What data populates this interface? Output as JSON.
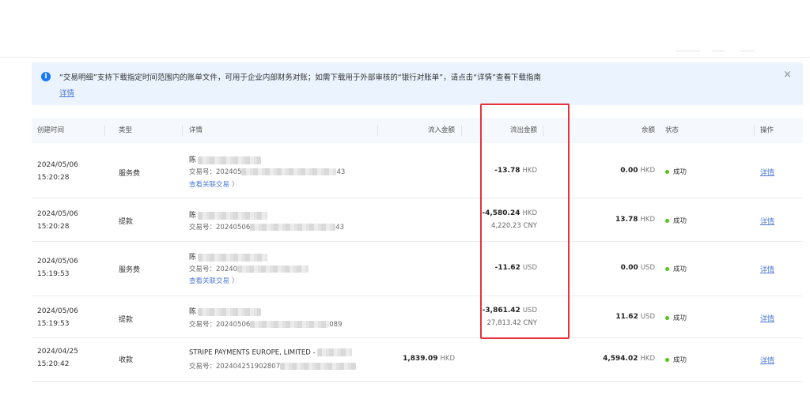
{
  "notice": {
    "message": "“交易明细”支持下载指定时间范围内的账单文件，可用于企业内部财务对账；如需下载用于外部审核的“银行对账单”，请点击“详情”查看下载指南",
    "link": "详情",
    "close": "×"
  },
  "columns": {
    "created": "创建时间",
    "type": "类型",
    "detail": "详情",
    "inflow": "流入金额",
    "outflow": "流出金额",
    "balance": "余额",
    "status": "状态",
    "action": "操作"
  },
  "rows": [
    {
      "date": "2024/05/06",
      "time": "15:20:28",
      "type": "服务费",
      "name": "陈",
      "txn": "交易号：202405",
      "txn_tail": "43",
      "related": "查看关联交易 〉",
      "inflow": "",
      "inflow_cur": "",
      "outflow": "-13.78",
      "outflow_cur": "HKD",
      "outflow_sub": "",
      "balance": "0.00",
      "balance_cur": "HKD",
      "status": "成功",
      "action": "详情"
    },
    {
      "date": "2024/05/06",
      "time": "15:20:28",
      "type": "提款",
      "name": "陈",
      "txn": "交易号：20240506",
      "txn_tail": "43",
      "related": "",
      "inflow": "",
      "inflow_cur": "",
      "outflow": "-4,580.24",
      "outflow_cur": "HKD",
      "outflow_sub": "4,220.23 CNY",
      "balance": "13.78",
      "balance_cur": "HKD",
      "status": "成功",
      "action": "详情"
    },
    {
      "date": "2024/05/06",
      "time": "15:19:53",
      "type": "服务费",
      "name": "陈",
      "txn": "交易号：20240",
      "txn_tail": "",
      "related": "查看关联交易 〉",
      "inflow": "",
      "inflow_cur": "",
      "outflow": "-11.62",
      "outflow_cur": "USD",
      "outflow_sub": "",
      "balance": "0.00",
      "balance_cur": "USD",
      "status": "成功",
      "action": "详情"
    },
    {
      "date": "2024/05/06",
      "time": "15:19:53",
      "type": "提款",
      "name": "陈",
      "txn": "交易号：20240506",
      "txn_tail": "089",
      "related": "",
      "inflow": "",
      "inflow_cur": "",
      "outflow": "-3,861.42",
      "outflow_cur": "USD",
      "outflow_sub": "27,813.42 CNY",
      "balance": "11.62",
      "balance_cur": "USD",
      "status": "成功",
      "action": "详情"
    },
    {
      "date": "2024/04/25",
      "time": "15:20:42",
      "type": "收款",
      "name": "STRIPE PAYMENTS EUROPE, LIMITED - ",
      "txn": "交易号：202404251902807",
      "txn_tail": "",
      "related": "",
      "inflow": "1,839.09",
      "inflow_cur": "HKD",
      "outflow": "",
      "outflow_cur": "",
      "outflow_sub": "",
      "balance": "4,594.02",
      "balance_cur": "HKD",
      "status": "成功",
      "action": "详情"
    }
  ],
  "colors": {
    "accent": "#1677ff",
    "link": "#4f7bd8",
    "success": "#52c41a",
    "highlight": "#e8323c",
    "notice_bg": "#eaf3fe"
  }
}
